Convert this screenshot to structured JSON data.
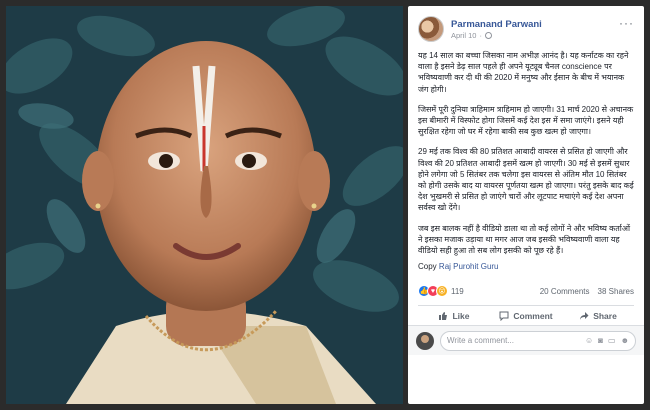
{
  "post": {
    "author": "Parmanand Parwani",
    "date": "April 10",
    "paragraphs": [
      "यह 14 साल का बच्चा जिसका नाम अभीज्ञ आनंद है। यह कर्नाटक का रहने वाला है इसने डेढ़ साल पहले ही अपने यूट्यूब चैनल conscience पर भविष्यवाणी कर दी थी की 2020 में मनुष्य और ईसान के बीच में भयानक जंग होगी।",
      "जिसमें पूरी दुनिया त्राहिमाम त्राहिमाम हो जाएगी। 31 मार्च 2020 से अचानक इस बीमारी में विस्फोट होगा जिसमें कई देश इस में समा जाएंगे। इसने यही सुरक्षित रहेगा जो घर में रहेगा बाकी सब कुछ खत्म हो जाएगा।",
      "29 मई तक विश्व की 80 प्रतिशत आबादी वायरस से प्रसित हो जाएगी और विश्व की 20 प्रतिशत आबादी इसमें खत्म हो जाएगी। 30 मई से इसमें सुधार होने लगेगा जो 5 सितंबर तक चलेगा इस वायरस से अंतिम मौत 10 सितंबर को होगी उसके बाद या वायरस पूर्णतया खत्म हो जाएगा। परंतु इसके बाद कई देश भुखमरी से प्रसित हो जाएंगे चारों और लूटपाट मचाएंगे कई देश अपना सर्वस्व खो देंगे।",
      "जब इस बालक नहीं है वीडियो डाला था तो कई लोगों ने और भविष्य कर्ताओं ने इसका मजाक उड़ाया था मगर आज जब इसकी भविष्यवाणी वाला यह वीडियो सही हुआ तो सब लोग इसकी को पूछ रहे हैं।"
    ],
    "copy_prefix": "Copy",
    "copy_link": "Raj Purohit Guru"
  },
  "stats": {
    "reaction_count": "119",
    "comments": "20 Comments",
    "shares": "38 Shares"
  },
  "actions": {
    "like": "Like",
    "comment": "Comment",
    "share": "Share"
  },
  "comment_box": {
    "placeholder": "Write a comment..."
  },
  "colors": {
    "link": "#385898",
    "like_blue": "#1877f2",
    "love_red": "#f33e58",
    "wow_yellow": "#f7b125"
  },
  "icons": {
    "globe": "globe-icon",
    "more": "more-icon",
    "like": "thumbs-up-icon",
    "comment": "speech-bubble-icon",
    "share": "share-arrow-icon",
    "emoji": "emoji-icon",
    "camera": "camera-icon",
    "gif": "gif-icon",
    "sticker": "sticker-icon"
  }
}
